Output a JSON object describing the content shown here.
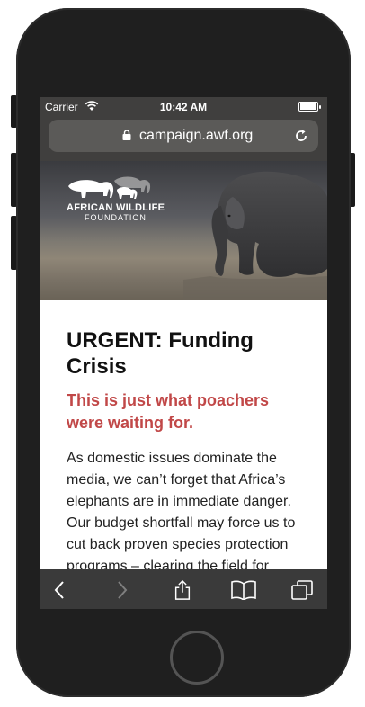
{
  "status": {
    "carrier": "Carrier",
    "time": "10:42 AM"
  },
  "browser": {
    "url": "campaign.awf.org"
  },
  "hero": {
    "logo_title": "AFRICAN WILDLIFE",
    "logo_subtitle": "FOUNDATION"
  },
  "article": {
    "headline": "URGENT: Funding Crisis",
    "subhead": "This is just what poachers were waiting for.",
    "body": "As domestic issues dominate the media, we can’t forget that Africa’s elephants are in immediate danger. Our budget shortfall may force us to cut back proven species protection programs – clearing the field for"
  },
  "colors": {
    "accent": "#c14848",
    "phone_body": "#1f1f1f",
    "browser_bar": "#403f3e"
  },
  "icons": [
    "wifi-icon",
    "battery-icon",
    "lock-icon",
    "reload-icon",
    "back-icon",
    "forward-icon",
    "share-icon",
    "bookmarks-icon",
    "tabs-icon"
  ]
}
